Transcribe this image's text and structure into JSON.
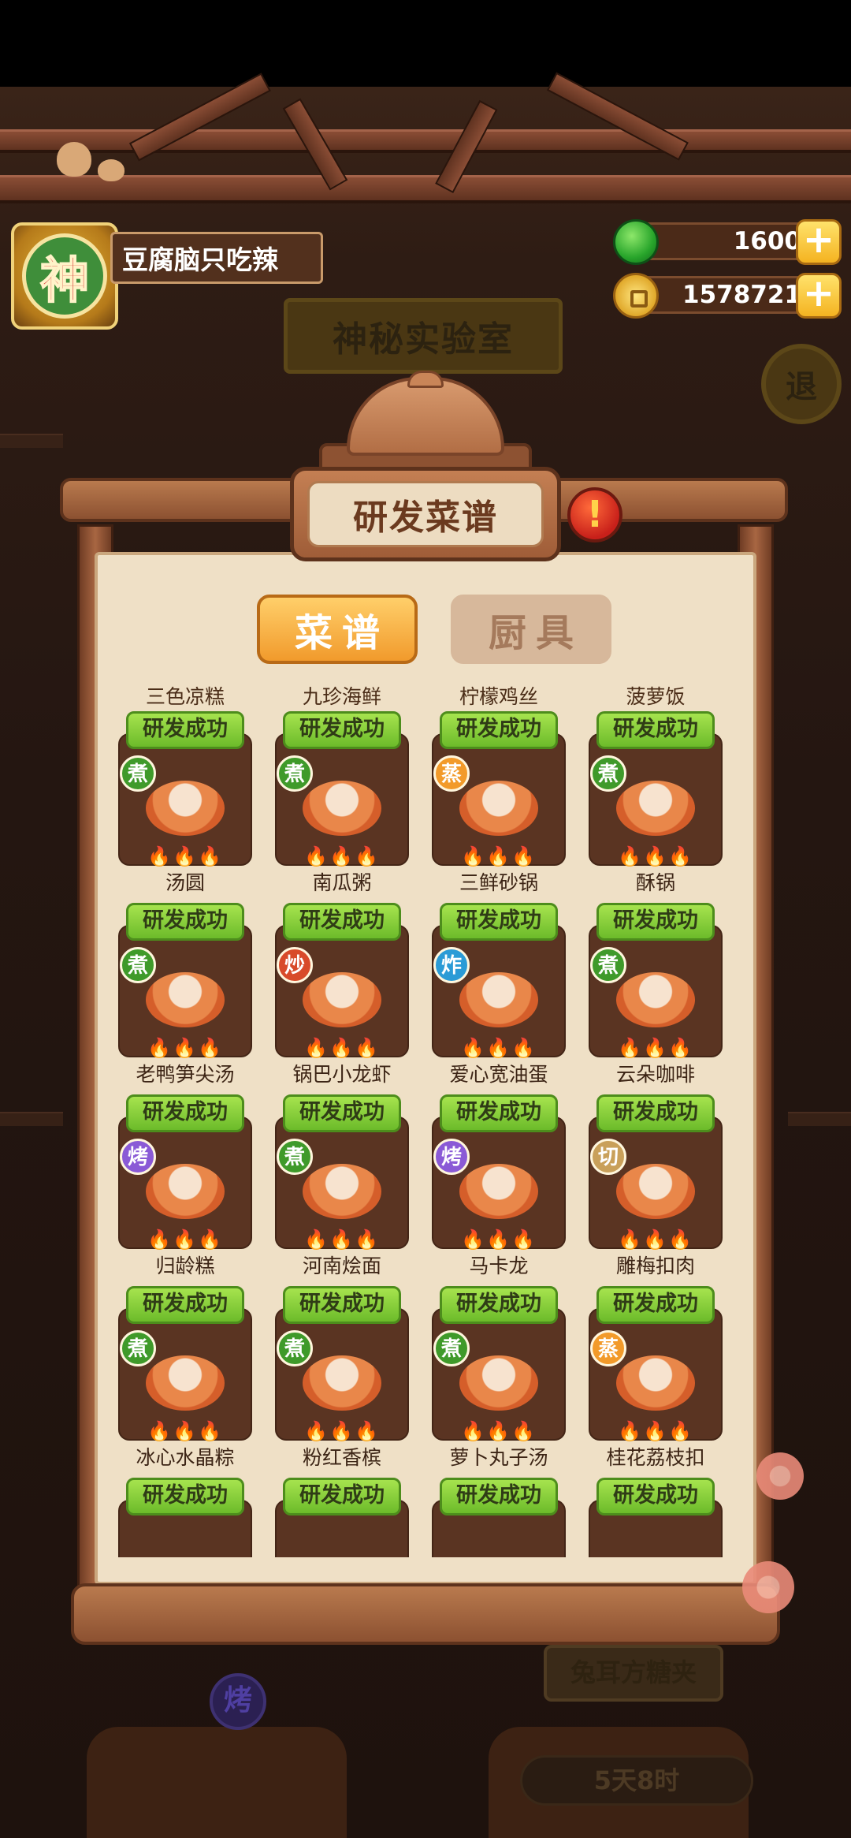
{
  "user": {
    "avatar_char": "神",
    "name": "豆腐脑只吃辣"
  },
  "currencies": [
    {
      "name": "jade",
      "value": "1600",
      "plus": "+"
    },
    {
      "name": "coin",
      "value": "1578721",
      "plus": "+"
    }
  ],
  "background": {
    "lab_sign": "神秘实验室",
    "exit": "退",
    "bottom_plate": "兔耳方糖夹",
    "bake_badge": "烤",
    "timer": "5天8时"
  },
  "dialog": {
    "title": "研发菜谱",
    "alert": "!",
    "tabs": [
      {
        "label": "菜谱",
        "active": true
      },
      {
        "label": "厨具",
        "active": false
      }
    ]
  },
  "partial_row_labels": [
    "三色凉糕",
    "九珍海鲜",
    "柠檬鸡丝",
    "菠萝饭"
  ],
  "recipes": [
    {
      "name": "汤圆",
      "status": "研发成功",
      "method": "煮",
      "flames": "🔥🔥🔥"
    },
    {
      "name": "南瓜粥",
      "status": "研发成功",
      "method": "煮",
      "flames": "🔥🔥🔥"
    },
    {
      "name": "三鲜砂锅",
      "status": "研发成功",
      "method": "蒸",
      "flames": "🔥🔥🔥"
    },
    {
      "name": "酥锅",
      "status": "研发成功",
      "method": "煮",
      "flames": "🔥🔥🔥"
    },
    {
      "name": "老鸭笋尖汤",
      "status": "研发成功",
      "method": "煮",
      "flames": "🔥🔥🔥"
    },
    {
      "name": "锅巴小龙虾",
      "status": "研发成功",
      "method": "炒",
      "flames": "🔥🔥🔥"
    },
    {
      "name": "爱心宽油蛋",
      "status": "研发成功",
      "method": "炸",
      "flames": "🔥🔥🔥"
    },
    {
      "name": "云朵咖啡",
      "status": "研发成功",
      "method": "煮",
      "flames": "🔥🔥🔥"
    },
    {
      "name": "归龄糕",
      "status": "研发成功",
      "method": "烤",
      "flames": "🔥🔥🔥"
    },
    {
      "name": "河南烩面",
      "status": "研发成功",
      "method": "煮",
      "flames": "🔥🔥🔥"
    },
    {
      "name": "马卡龙",
      "status": "研发成功",
      "method": "烤",
      "flames": "🔥🔥🔥"
    },
    {
      "name": "雕梅扣肉",
      "status": "研发成功",
      "method": "切",
      "flames": "🔥🔥🔥"
    },
    {
      "name": "冰心水晶粽",
      "status": "研发成功",
      "method": "煮",
      "flames": "🔥🔥🔥"
    },
    {
      "name": "粉红香槟",
      "status": "研发成功",
      "method": "煮",
      "flames": "🔥🔥🔥"
    },
    {
      "name": "萝卜丸子汤",
      "status": "研发成功",
      "method": "煮",
      "flames": "🔥🔥🔥"
    },
    {
      "name": "桂花荔枝扣",
      "status": "研发成功",
      "method": "蒸",
      "flames": "🔥🔥🔥"
    },
    {
      "name": "",
      "status": "研发成功",
      "method": "",
      "flames": ""
    },
    {
      "name": "",
      "status": "研发成功",
      "method": "",
      "flames": ""
    },
    {
      "name": "",
      "status": "研发成功",
      "method": "",
      "flames": ""
    },
    {
      "name": "",
      "status": "研发成功",
      "method": "",
      "flames": ""
    }
  ],
  "colors": {
    "status_green": "#8fd13e",
    "tab_active": "#f4a93a",
    "panel": "#efe0c6"
  }
}
